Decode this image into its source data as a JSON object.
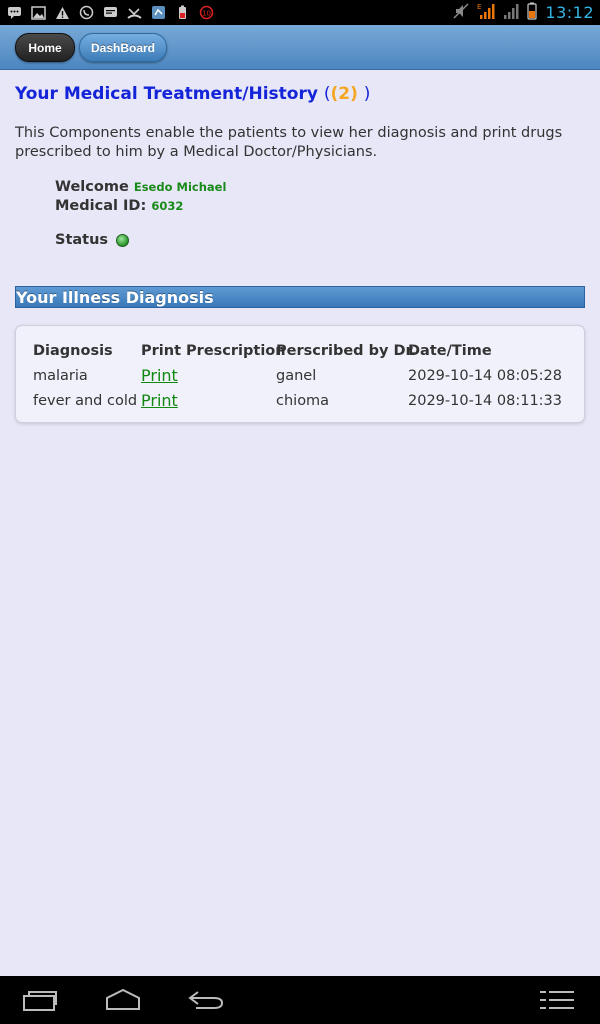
{
  "status_bar": {
    "time": "13:12",
    "notification_badge": "10"
  },
  "header": {
    "home_label": "Home",
    "dashboard_label": "DashBoard"
  },
  "page": {
    "title": "Your Medical Treatment/History",
    "title_paren_open": "(",
    "count": "(2)",
    "title_paren_close": ")",
    "intro": "This Components enable the patients to view her diagnosis and print drugs prescribed to him by a Medical Doctor/Physicians."
  },
  "patient": {
    "welcome_label": "Welcome",
    "name": "Esedo Michael",
    "medical_id_label": "Medical ID:",
    "medical_id": "6032",
    "status_label": "Status"
  },
  "section": {
    "title": "Your Illness Diagnosis"
  },
  "table": {
    "headers": [
      "Diagnosis",
      "Print Prescription",
      "Perscribed by Dr.",
      "Date/Time"
    ],
    "rows": [
      {
        "diagnosis": "malaria",
        "print": "Print",
        "doctor": "ganel",
        "datetime": "2029-10-14 08:05:28"
      },
      {
        "diagnosis": "fever and cold",
        "print": "Print",
        "doctor": "chioma",
        "datetime": "2029-10-14 08:11:33"
      }
    ]
  },
  "colors": {
    "title": "#1424d8",
    "count": "#f5a623",
    "link": "#118811",
    "accent": "#4c86c0",
    "status_online": "#2e9a2e"
  }
}
